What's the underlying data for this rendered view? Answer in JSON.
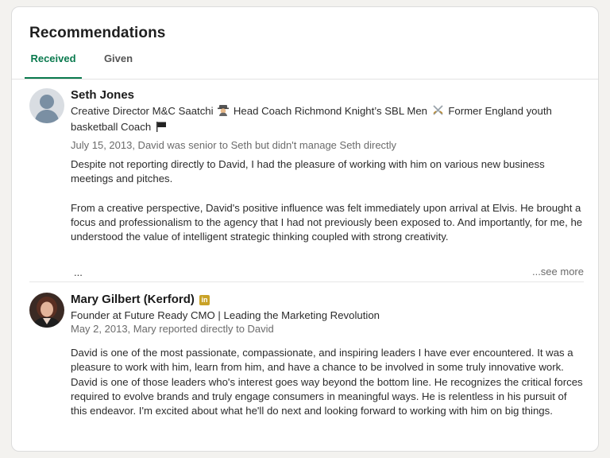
{
  "section": {
    "title": "Recommendations",
    "tabs": [
      "Received",
      "Given"
    ],
    "active_tab": "Received"
  },
  "colors": {
    "accent": "#0a7a4e",
    "meta_text": "#6b6b6b",
    "linkedin_badge": "#c9a227"
  },
  "recommendations": [
    {
      "name": "Seth Jones",
      "headline_parts": [
        "Creative Director M&C Saatchi",
        "Head Coach Richmond Knight’s SBL Men",
        "Former England youth basketball Coach"
      ],
      "headline_icons": [
        "detective-emoji-icon",
        "crossed-swords-emoji-icon",
        "black-flag-emoji-icon"
      ],
      "meta": "July 15, 2013, David was senior to Seth but didn't manage Seth directly",
      "body_paragraphs": [
        "Despite not reporting directly to David, I had the pleasure of working with him on various new business meetings and pitches.",
        "From a creative perspective, David's positive influence was felt immediately upon arrival at Elvis. He brought a focus and professionalism to the agency that I had not previously been exposed to. And importantly, for me, he understood the value of intelligent strategic thinking coupled with strong creativity."
      ],
      "truncation": "...",
      "see_more": "...see more",
      "avatar": "default-person-avatar"
    },
    {
      "name": "Mary Gilbert (Kerford)",
      "badge": "in",
      "headline": "Founder at Future Ready CMO | Leading the Marketing Revolution",
      "meta": "May 2, 2013, Mary reported directly to David",
      "body_paragraphs": [
        "David is one of the most passionate, compassionate, and inspiring leaders I have ever encountered. It was a pleasure to work with him, learn from him, and have a chance to be involved in some truly innovative work. David is one of those leaders who's interest goes way beyond the bottom line. He recognizes the critical forces required to evolve brands and truly engage consumers in meaningful ways. He is relentless in his pursuit of this endeavor. I'm excited about what he'll do next and looking forward to working with him on big things."
      ],
      "avatar": "photo-avatar"
    }
  ]
}
